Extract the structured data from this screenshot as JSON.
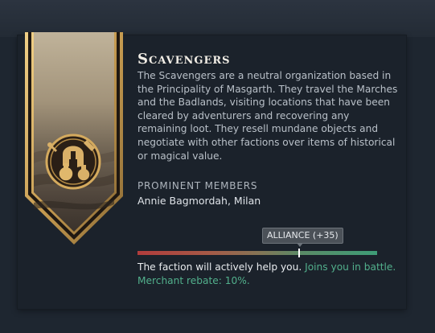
{
  "faction": {
    "name": "Scavengers",
    "description": "The Scavengers are a neutral organization based in the Principality of Masgarth. They travel the Marches and the Badlands, visiting locations that have been cleared by adventurers and recovering any remaining loot. They resell mundane objects and negotiate with other factions over items of historical or magical value.",
    "emblem_icon": "scavengers-emblem-icon"
  },
  "members": {
    "heading": "PROMINENT MEMBERS",
    "names": "Annie Bagmordah, Milan"
  },
  "reputation": {
    "tooltip": "ALLIANCE (+35)",
    "level_fraction": 0.675,
    "effect_text": "The faction will actively help you.",
    "bonus_text": "Joins you in battle. Merchant rebate: 10%."
  },
  "colors": {
    "background": "#1e2630",
    "panel": "#1b222b",
    "gold": "#c9a25a",
    "positive_text": "#52b08c",
    "negative": "#b13c3c"
  }
}
